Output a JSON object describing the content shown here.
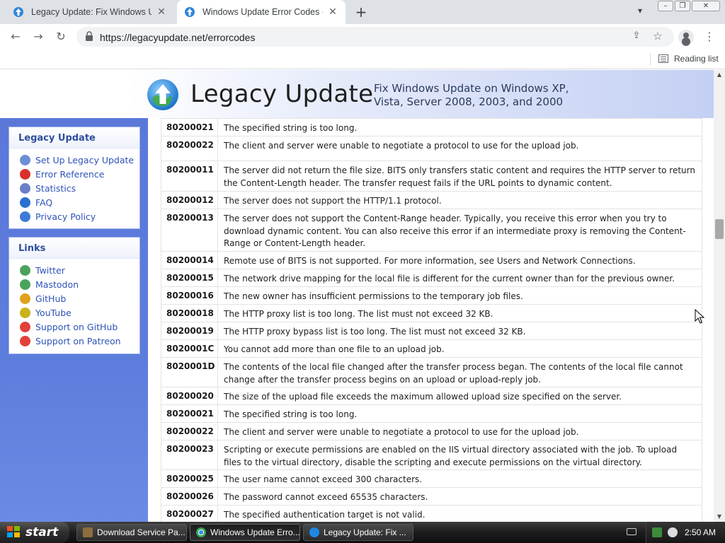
{
  "browser": {
    "tabs": [
      {
        "title": "Legacy Update: Fix Windows Update",
        "active": false
      },
      {
        "title": "Windows Update Error Codes - Legacy Update",
        "active": true
      }
    ],
    "new_tab_icon": "+",
    "url": "https://legacyupdate.net/errorcodes",
    "reading_list_label": "Reading list"
  },
  "site": {
    "name": "Legacy Update",
    "tagline_line1": "Fix Windows Update on Windows XP,",
    "tagline_line2": "Vista, Server 2008, 2003, and 2000"
  },
  "sidebar": {
    "legacy_box": {
      "title": "Legacy Update",
      "items": [
        {
          "label": "Set Up Legacy Update",
          "icon": "setup-icon"
        },
        {
          "label": "Error Reference",
          "icon": "error-icon"
        },
        {
          "label": "Statistics",
          "icon": "statistics-icon"
        },
        {
          "label": "FAQ",
          "icon": "help-icon"
        },
        {
          "label": "Privacy Policy",
          "icon": "privacy-icon"
        }
      ]
    },
    "links_box": {
      "title": "Links",
      "items": [
        {
          "label": "Twitter",
          "icon": "twitter-icon"
        },
        {
          "label": "Mastodon",
          "icon": "mastodon-icon"
        },
        {
          "label": "GitHub",
          "icon": "github-icon"
        },
        {
          "label": "YouTube",
          "icon": "youtube-icon"
        },
        {
          "label": "Support on GitHub",
          "icon": "heart-icon"
        },
        {
          "label": "Support on Patreon",
          "icon": "heart-icon"
        }
      ]
    }
  },
  "errors": [
    {
      "code": "80200021",
      "desc": "The specified string is too long.",
      "h": 25
    },
    {
      "code": "80200022",
      "desc": "The client and server were unable to negotiate a protocol to use for the upload job.",
      "h": 35
    },
    {
      "code": "80200011",
      "desc": "The server did not return the file size. BITS only transfers static content and requires the HTTP server to return the Content-Length header. The transfer request fails if the URL points to dynamic content.",
      "h": 43
    },
    {
      "code": "80200012",
      "desc": "The server does not support the HTTP/1.1 protocol.",
      "h": 25
    },
    {
      "code": "80200013",
      "desc": "The server does not support the Content-Range header. Typically, you receive this error when you try to download dynamic content. You can also receive this error if an intermediate proxy is removing the Content-Range or Content-Length header.",
      "h": 60
    },
    {
      "code": "80200014",
      "desc": "Remote use of BITS is not supported. For more information, see Users and Network Connections.",
      "h": 25
    },
    {
      "code": "80200015",
      "desc": "The network drive mapping for the local file is different for the current owner than for the previous owner.",
      "h": 25
    },
    {
      "code": "80200016",
      "desc": "The new owner has insufficient permissions to the temporary job files.",
      "h": 25
    },
    {
      "code": "80200018",
      "desc": "The HTTP proxy list is too long. The list must not exceed 32 KB.",
      "h": 25
    },
    {
      "code": "80200019",
      "desc": "The HTTP proxy bypass list is too long. The list must not exceed 32 KB.",
      "h": 25
    },
    {
      "code": "8020001C",
      "desc": "You cannot add more than one file to an upload job.",
      "h": 25
    },
    {
      "code": "8020001D",
      "desc": "The contents of the local file changed after the transfer process began. The contents of the local file cannot change after the transfer process begins on an upload or upload-reply job.",
      "h": 42
    },
    {
      "code": "80200020",
      "desc": "The size of the upload file exceeds the maximum allowed upload size specified on the server.",
      "h": 25
    },
    {
      "code": "80200021",
      "desc": "The specified string is too long.",
      "h": 25
    },
    {
      "code": "80200022",
      "desc": "The client and server were unable to negotiate a protocol to use for the upload job.",
      "h": 25
    },
    {
      "code": "80200023",
      "desc": "Scripting or execute permissions are enabled on the IIS virtual directory associated with the job. To upload files to the virtual directory, disable the scripting and execute permissions on the virtual directory.",
      "h": 42
    },
    {
      "code": "80200025",
      "desc": "The user name cannot exceed 300 characters.",
      "h": 25
    },
    {
      "code": "80200026",
      "desc": "The password cannot exceed 65535 characters.",
      "h": 25
    },
    {
      "code": "80200027",
      "desc": "The specified authentication target is not valid.",
      "h": 25
    }
  ],
  "taskbar": {
    "start_label": "start",
    "tasks": [
      {
        "label": "Download Service Pa...",
        "active": false
      },
      {
        "label": "Windows Update Erro...",
        "active": true
      },
      {
        "label": "Legacy Update: Fix ...",
        "active": false
      }
    ],
    "clock": "2:50 AM"
  }
}
